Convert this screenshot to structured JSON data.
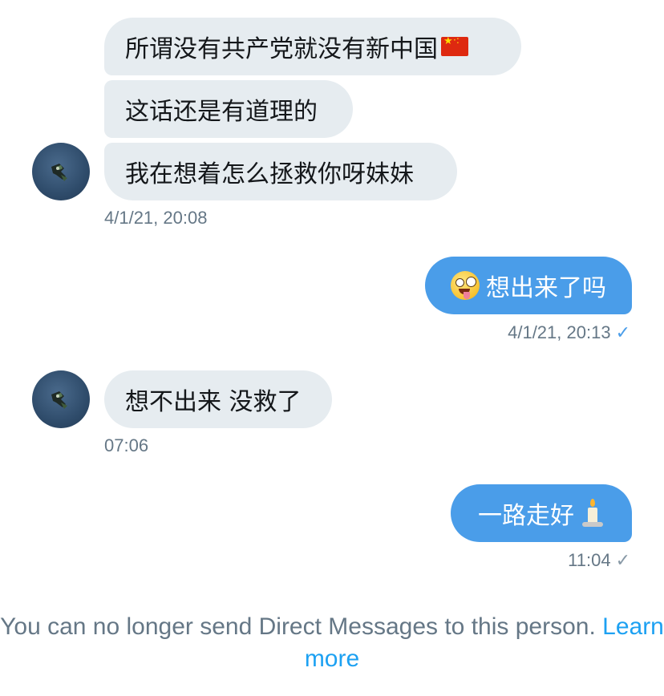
{
  "conversation": {
    "incoming_group_1": {
      "messages": [
        "所谓没有共产党就没有新中国",
        "这话还是有道理的",
        "我在想着怎么拯救你呀妹妹"
      ],
      "flag_emoji": "🇨🇳",
      "timestamp": "4/1/21, 20:08"
    },
    "outgoing_1": {
      "emoji": "🤪",
      "text": "想出来了吗",
      "timestamp": "4/1/21, 20:13",
      "read_mark": "✓"
    },
    "incoming_2": {
      "text": "想不出来 没救了",
      "timestamp": "07:06"
    },
    "outgoing_2": {
      "text": "一路走好",
      "emoji": "🕯️",
      "timestamp": "11:04",
      "read_mark": "✓"
    }
  },
  "footer": {
    "notice_text": "You can no longer send Direct Messages to this person.",
    "link_text": "Learn more"
  },
  "colors": {
    "incoming_bubble": "#e6ecf0",
    "outgoing_bubble": "#4a9de9",
    "timestamp": "#657786",
    "link": "#1da1f2"
  }
}
